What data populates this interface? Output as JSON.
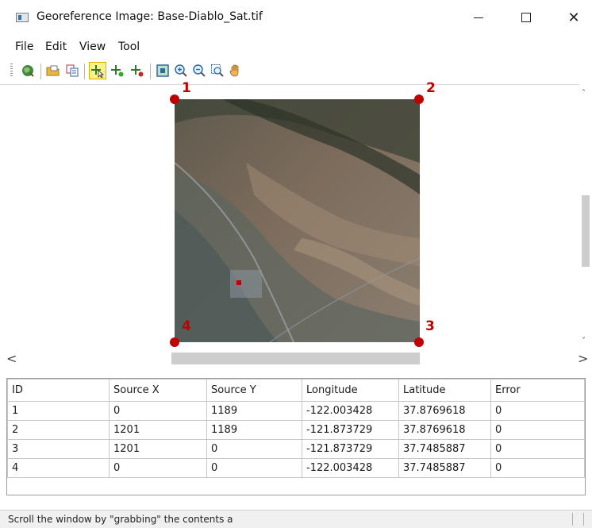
{
  "window": {
    "title": "Georeference Image: Base-Diablo_Sat.tif",
    "minimize_symbol": "—",
    "close_symbol": "✕"
  },
  "menu": {
    "items": [
      {
        "label": "File"
      },
      {
        "label": "Edit"
      },
      {
        "label": "View"
      },
      {
        "label": "Tool"
      }
    ]
  },
  "toolbar": {
    "buttons": [
      {
        "icon": "georeference-icon"
      },
      {
        "icon": "open-folder-icon"
      },
      {
        "icon": "copy-points-icon"
      },
      {
        "icon": "select-point-icon",
        "active": true
      },
      {
        "icon": "add-point-icon"
      },
      {
        "icon": "delete-point-icon"
      },
      {
        "icon": "zoom-extent-icon"
      },
      {
        "icon": "zoom-in-icon"
      },
      {
        "icon": "zoom-out-icon"
      },
      {
        "icon": "zoom-window-icon"
      },
      {
        "icon": "pan-hand-icon"
      }
    ]
  },
  "image": {
    "control_points": [
      {
        "label": "1"
      },
      {
        "label": "2"
      },
      {
        "label": "3"
      },
      {
        "label": "4"
      }
    ],
    "marker_color": "#c00000"
  },
  "scrollbars": {
    "left_arrow": "<",
    "right_arrow": ">"
  },
  "table": {
    "columns": [
      "ID",
      "Source X",
      "Source Y",
      "Longitude",
      "Latitude",
      "Error"
    ],
    "rows": [
      [
        "1",
        "0",
        "1189",
        "-122.003428",
        "37.8769618",
        "0"
      ],
      [
        "2",
        "1201",
        "1189",
        "-121.873729",
        "37.8769618",
        "0"
      ],
      [
        "3",
        "1201",
        "0",
        "-121.873729",
        "37.7485887",
        "0"
      ],
      [
        "4",
        "0",
        "0",
        "-122.003428",
        "37.7485887",
        "0"
      ]
    ]
  },
  "status": {
    "text": "Scroll the window by \"grabbing\" the contents a"
  }
}
